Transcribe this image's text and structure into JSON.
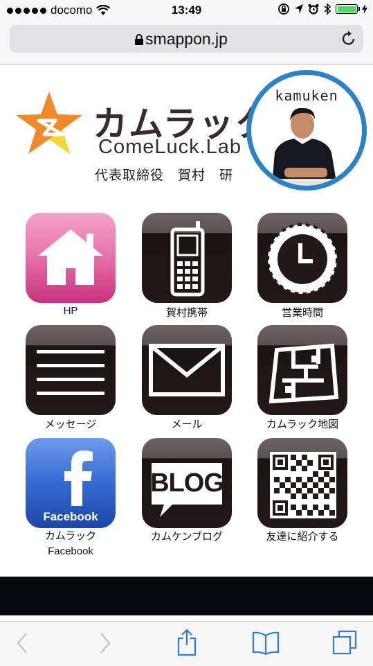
{
  "status_bar": {
    "carrier": "docomo",
    "time": "13:49"
  },
  "browser": {
    "url": "smappon.jp"
  },
  "header": {
    "brand": "カムラック",
    "brand_sub": "ComeLuck.Lab",
    "person_title": "代表取締役　賀村　研",
    "avatar_name": "kamuken",
    "colors": {
      "brand_text": "#3a2a28",
      "star_orange": "#ef8a2b",
      "star_yellow": "#f7d43a",
      "avatar_ring": "#2b83c6"
    }
  },
  "apps": [
    {
      "label": "HP",
      "icon": "home-icon"
    },
    {
      "label": "賀村携帯",
      "icon": "mobile-phone-icon"
    },
    {
      "label": "営業時間",
      "icon": "clock-icon"
    },
    {
      "label": "メッセージ",
      "icon": "message-lines-icon"
    },
    {
      "label": "メール",
      "icon": "envelope-icon"
    },
    {
      "label": "カムラック地図",
      "icon": "map-icon"
    },
    {
      "label": "カムラック",
      "label2": "Facebook",
      "icon": "facebook-icon",
      "icon_text": "Facebook"
    },
    {
      "label": "カムケンブログ",
      "icon": "blog-icon",
      "icon_text": "BLOG"
    },
    {
      "label": "友達に紹介する",
      "icon": "qr-code-icon"
    }
  ],
  "toolbar": {
    "items": [
      "back-icon",
      "forward-icon",
      "share-icon",
      "bookmarks-icon",
      "tabs-icon"
    ]
  }
}
